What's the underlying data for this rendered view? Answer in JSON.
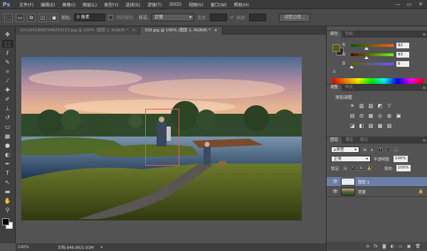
{
  "app": {
    "logo": "Ps",
    "menu": [
      "文件(F)",
      "编辑(E)",
      "图像(I)",
      "图层(L)",
      "类型(Y)",
      "选择(S)",
      "滤镜(T)",
      "3D(D)",
      "视图(V)",
      "窗口(W)",
      "帮助(H)"
    ],
    "window_controls": [
      "—",
      "▭",
      "✕"
    ]
  },
  "options_bar": {
    "feather_label": "羽化:",
    "feather_value": "0 像素",
    "antialias_label": "消除锯齿",
    "style_label": "样式:",
    "style_value": "正常",
    "width_label": "宽度:",
    "height_label": "高度:",
    "refine_button": "调整边缘..."
  },
  "tabs": [
    {
      "label": "20120519083346253223.jpg @ 100% (图层 1, RGB/8) *",
      "close": "×",
      "active": false
    },
    {
      "label": "333.jpg @ 100% (图层 1, RGB/8) *",
      "close": "×",
      "active": true
    }
  ],
  "toolbar": {
    "tools": [
      {
        "name": "move-tool-icon",
        "glyph": "✥"
      },
      {
        "name": "marquee-tool-icon",
        "glyph": "⬚"
      },
      {
        "name": "lasso-tool-icon",
        "glyph": "ℓ"
      },
      {
        "name": "quick-select-tool-icon",
        "glyph": "✎"
      },
      {
        "name": "crop-tool-icon",
        "glyph": "⌗"
      },
      {
        "name": "eyedropper-tool-icon",
        "glyph": "⁄"
      },
      {
        "name": "healing-tool-icon",
        "glyph": "✚"
      },
      {
        "name": "brush-tool-icon",
        "glyph": "✐"
      },
      {
        "name": "clone-stamp-tool-icon",
        "glyph": "⊥"
      },
      {
        "name": "history-brush-tool-icon",
        "glyph": "↺"
      },
      {
        "name": "eraser-tool-icon",
        "glyph": "▭"
      },
      {
        "name": "gradient-tool-icon",
        "glyph": "▦"
      },
      {
        "name": "blur-tool-icon",
        "glyph": "●"
      },
      {
        "name": "dodge-tool-icon",
        "glyph": "◐"
      },
      {
        "name": "pen-tool-icon",
        "glyph": "✒"
      },
      {
        "name": "type-tool-icon",
        "glyph": "T"
      },
      {
        "name": "path-select-tool-icon",
        "glyph": "↖"
      },
      {
        "name": "shape-tool-icon",
        "glyph": "▬"
      },
      {
        "name": "hand-tool-icon",
        "glyph": "✋"
      },
      {
        "name": "zoom-tool-icon",
        "glyph": "⚲"
      }
    ]
  },
  "status_bar": {
    "zoom": "100%",
    "doc_info": "文档:846.8K/1.93M"
  },
  "color_panel": {
    "tabs": [
      "颜色",
      "色板"
    ],
    "channels": [
      {
        "label": "R",
        "value": "92",
        "pos": 0.36
      },
      {
        "label": "G",
        "value": "93",
        "pos": 0.36
      },
      {
        "label": "B",
        "value": "6",
        "pos": 0.02
      }
    ],
    "fg_color": "#5c5d06"
  },
  "adjust_panel": {
    "tabs": [
      "调整",
      "样式"
    ],
    "title": "添加调整",
    "row1": [
      "☀",
      "▥",
      "▨",
      "◩",
      "▽"
    ],
    "row2": [
      "▤",
      "⚖",
      "▦",
      "◎",
      "◍",
      "▣"
    ],
    "row3": [
      "◪",
      "◧",
      "▧",
      "▩",
      "▨"
    ]
  },
  "layers_panel": {
    "tabs": [
      "图层",
      "通道",
      "路径"
    ],
    "filter_label": "ρ类型",
    "blend_mode": "正常",
    "opacity_label": "不透明度:",
    "opacity_value": "100%",
    "lock_label": "锁定:",
    "fill_label": "填充:",
    "fill_value": "100%",
    "layers": [
      {
        "name": "图层 1",
        "selected": true,
        "locked": false
      },
      {
        "name": "背景",
        "selected": false,
        "locked": true
      }
    ],
    "footer_icons": [
      "⊖",
      "fx",
      "◙",
      "◐",
      "▭",
      "▣",
      "🗑"
    ]
  }
}
